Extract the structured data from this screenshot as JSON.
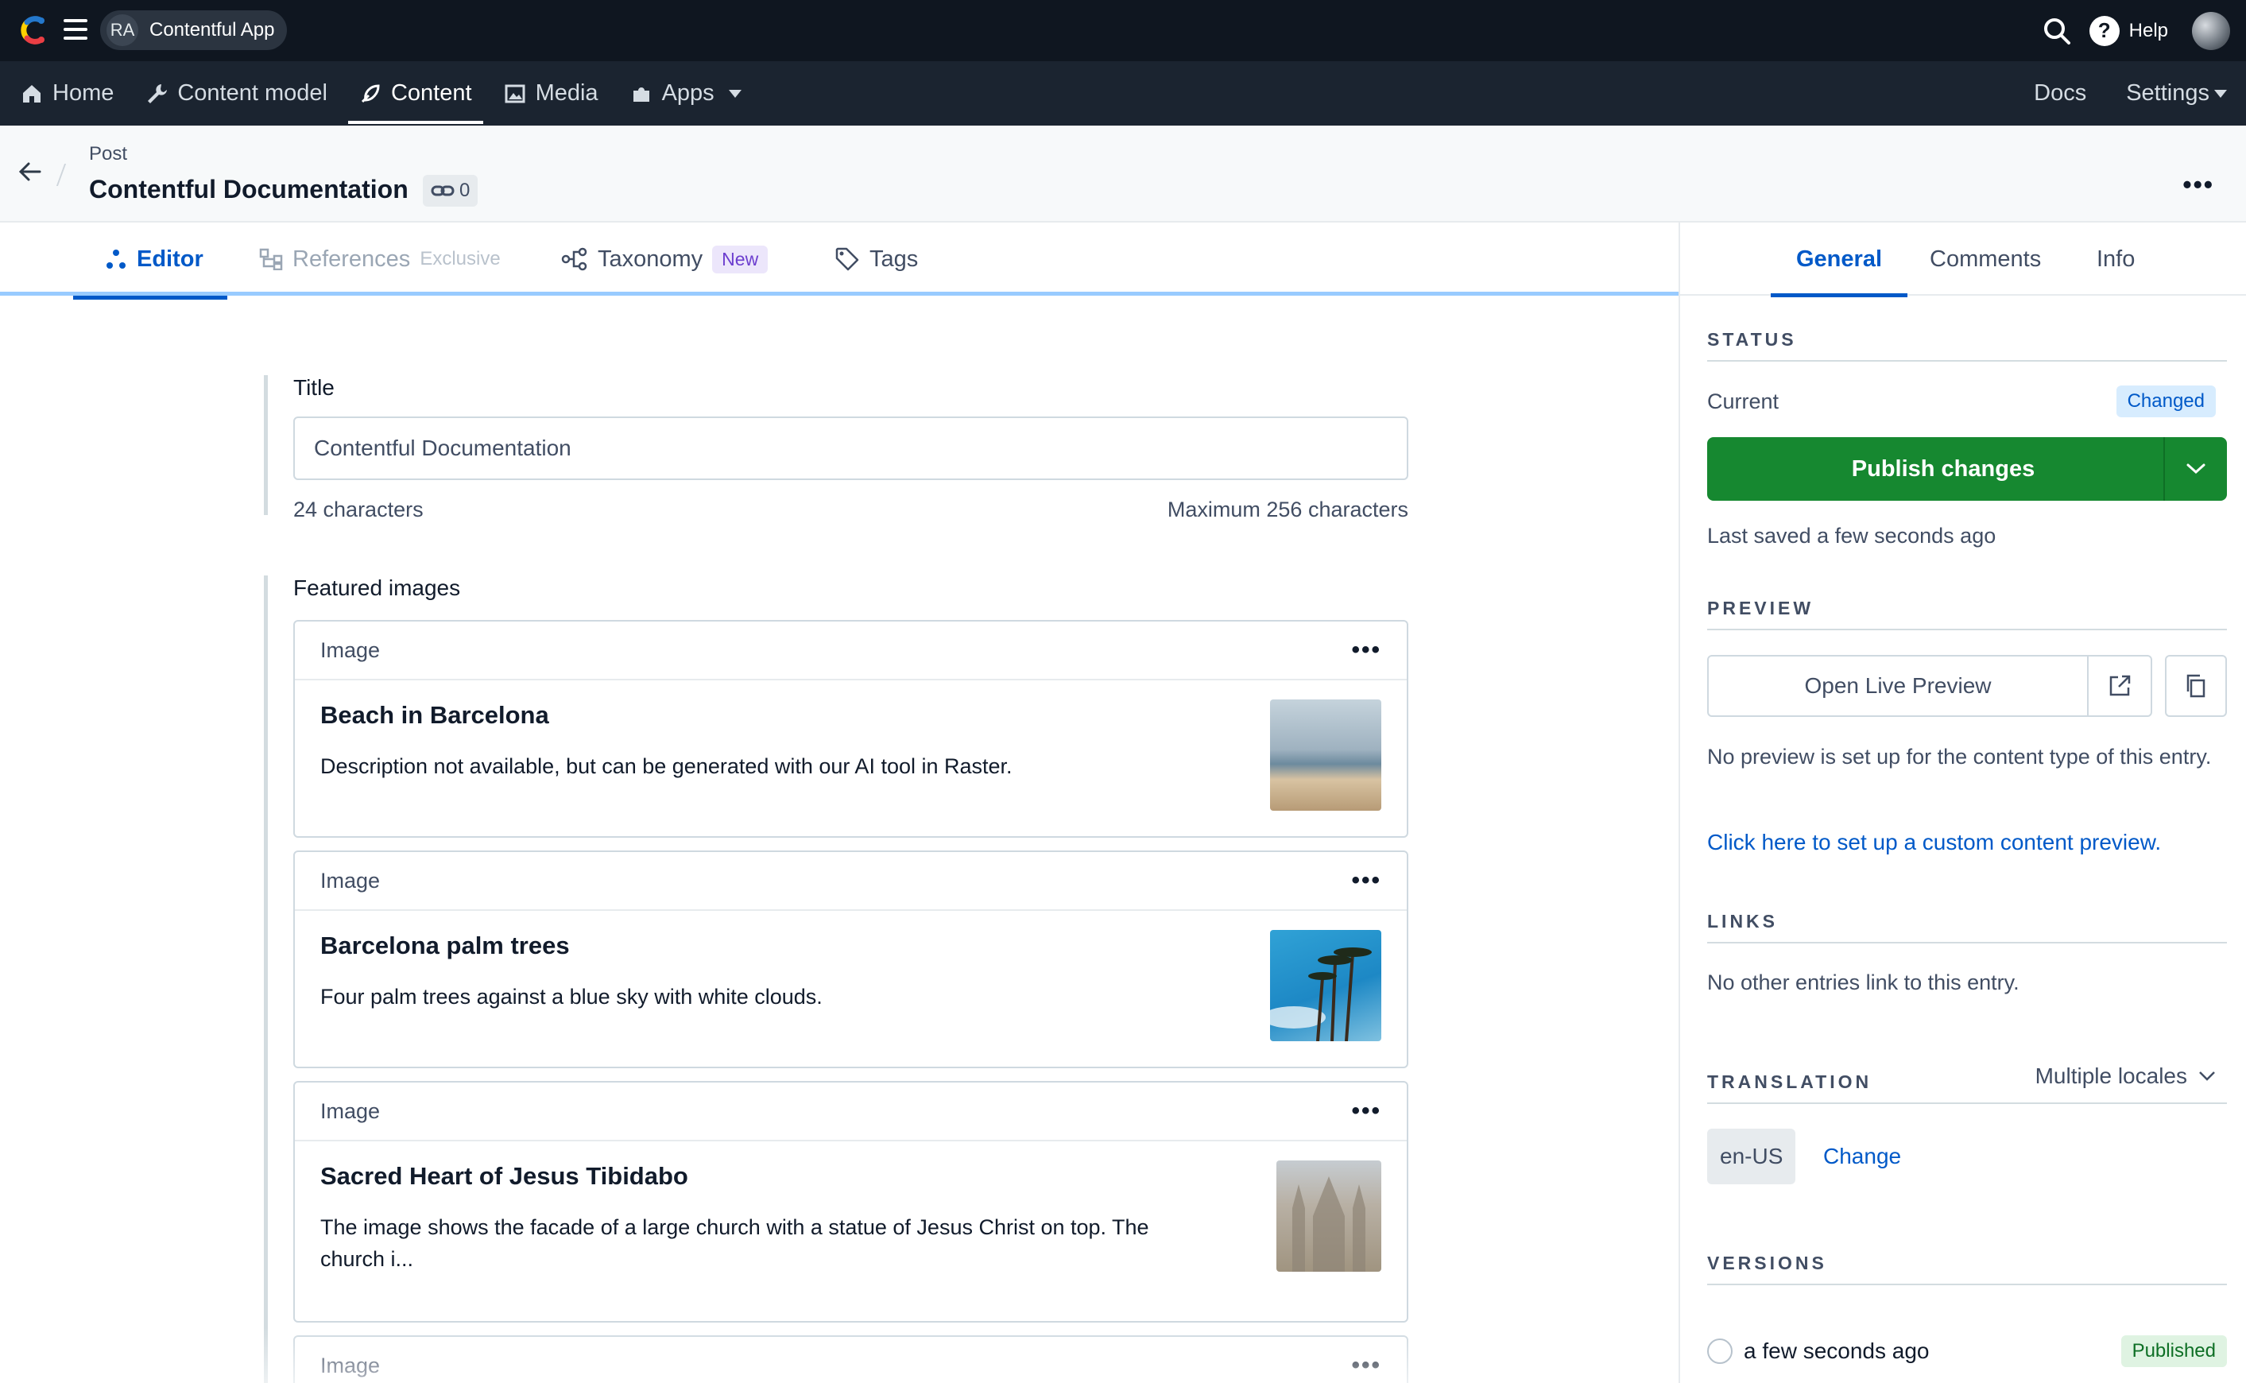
{
  "topbar": {
    "space_initials": "RA",
    "space_name": "Contentful App",
    "help_label": "Help"
  },
  "nav": {
    "items": [
      {
        "label": "Home",
        "icon": "home-icon"
      },
      {
        "label": "Content model",
        "icon": "wrench-icon"
      },
      {
        "label": "Content",
        "icon": "feather-icon",
        "active": true
      },
      {
        "label": "Media",
        "icon": "image-icon"
      },
      {
        "label": "Apps",
        "icon": "puzzle-icon"
      }
    ],
    "docs": "Docs",
    "settings": "Settings"
  },
  "entry": {
    "content_type": "Post",
    "title": "Contentful Documentation",
    "reference_count": "0"
  },
  "tabs": {
    "editor": "Editor",
    "references": "References",
    "references_tag": "Exclusive",
    "taxonomy": "Taxonomy",
    "taxonomy_badge": "New",
    "tags": "Tags"
  },
  "fields": {
    "title": {
      "label": "Title",
      "value": "Contentful Documentation",
      "count": "24 characters",
      "max": "Maximum 256 characters"
    },
    "featured": {
      "label": "Featured images",
      "cards": [
        {
          "type": "Image",
          "title": "Beach in Barcelona",
          "description": "Description not available, but can be generated with our AI tool in Raster."
        },
        {
          "type": "Image",
          "title": "Barcelona palm trees",
          "description": "Four palm trees against a blue sky with white clouds."
        },
        {
          "type": "Image",
          "title": "Sacred Heart of Jesus Tibidabo",
          "description": "The image shows the facade of a large church with a statue of Jesus Christ on top. The church i..."
        },
        {
          "type": "Image"
        }
      ]
    }
  },
  "sidebar": {
    "tabs": [
      "General",
      "Comments",
      "Info"
    ],
    "status": {
      "heading": "STATUS",
      "current_label": "Current",
      "badge": "Changed",
      "publish_label": "Publish changes",
      "last_saved": "Last saved a few seconds ago"
    },
    "preview": {
      "heading": "PREVIEW",
      "button": "Open Live Preview",
      "note": "No preview is set up for the content type of this entry.",
      "link": "Click here to set up a custom content preview."
    },
    "links": {
      "heading": "LINKS",
      "text": "No other entries link to this entry."
    },
    "translation": {
      "heading": "TRANSLATION",
      "mode": "Multiple locales",
      "locale": "en-US",
      "change": "Change"
    },
    "versions": {
      "heading": "VERSIONS",
      "items": [
        {
          "time": "a few seconds ago",
          "badge": "Published"
        }
      ]
    }
  },
  "colors": {
    "topbar": "#0f1620",
    "nav": "#1b2430",
    "accent": "#0059c8",
    "publish": "#168830"
  }
}
